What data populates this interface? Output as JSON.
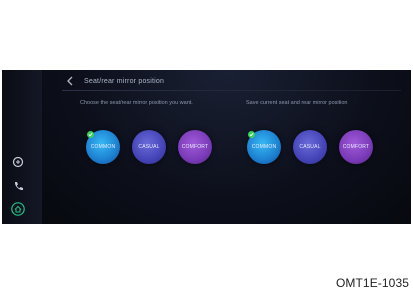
{
  "screen": {
    "title": "Seat/rear mirror position",
    "left_panel": {
      "label": "Choose the seat/rear mirror position you want.",
      "options": [
        {
          "label": "COMMON",
          "selected": true
        },
        {
          "label": "CASUAL",
          "selected": false
        },
        {
          "label": "COMFORT",
          "selected": false
        }
      ]
    },
    "right_panel": {
      "label": "Save current seat and rear mirror position",
      "options": [
        {
          "label": "COMMON",
          "selected": true
        },
        {
          "label": "CASUAL",
          "selected": false
        },
        {
          "label": "COMFORT",
          "selected": false
        }
      ]
    },
    "rail_icons": [
      "voice-icon",
      "phone-icon",
      "home-icon"
    ],
    "colors": {
      "common": "#1c7fd0",
      "casual": "#4444b8",
      "comfort": "#7a3ab8",
      "check": "#39d05a"
    }
  },
  "caption": "OMT1E-1035"
}
